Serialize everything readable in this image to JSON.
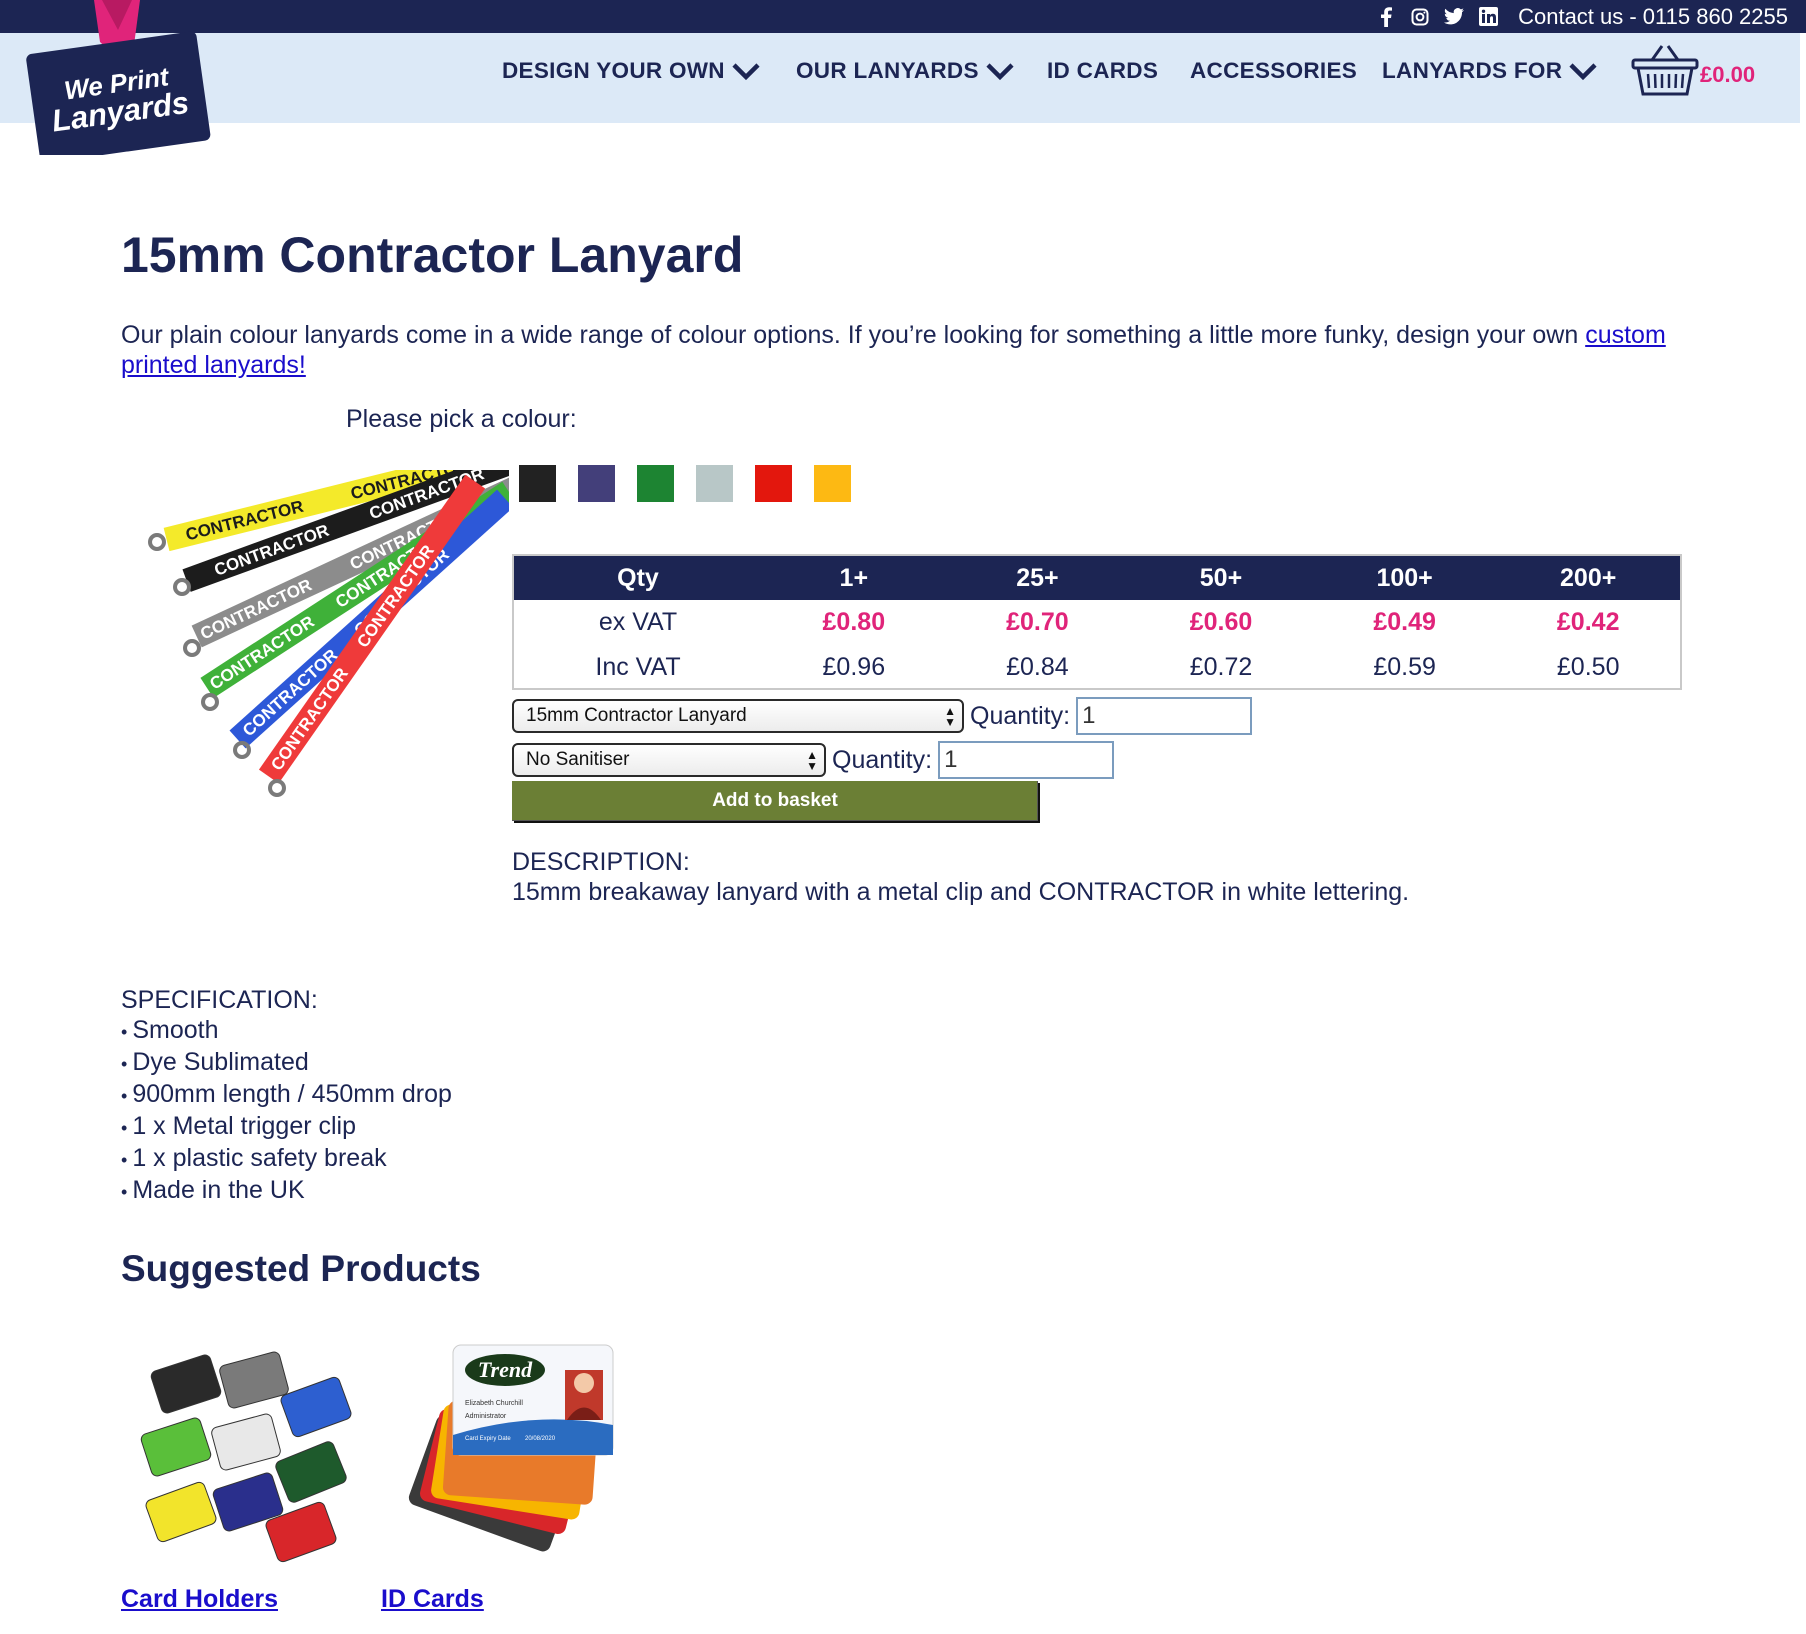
{
  "topbar": {
    "icons": [
      "facebook-icon",
      "instagram-icon",
      "twitter-icon",
      "linkedin-icon"
    ],
    "contact": "Contact us - 0115 860 2255"
  },
  "logo": {
    "line1": "We Print",
    "line2": "Lanyards"
  },
  "nav": {
    "items": [
      "DESIGN YOUR OWN",
      "OUR LANYARDS",
      "ID CARDS",
      "ACCESSORIES",
      "LANYARDS FOR"
    ],
    "basket_total": "£0.00"
  },
  "product": {
    "title": "15mm Contractor Lanyard",
    "intro_text": "Our plain colour lanyards come in a wide range of colour options. If you’re looking for something a little more funky, design your own ",
    "intro_link": "custom printed lanyards!",
    "pick_colour": "Please pick a colour:",
    "swatches": [
      "#222222",
      "#433f7a",
      "#1d8432",
      "#b8c7c7",
      "#e3170d",
      "#fdb913"
    ]
  },
  "pricing": {
    "headers": [
      "Qty",
      "1+",
      "25+",
      "50+",
      "100+",
      "200+"
    ],
    "ex_vat": [
      "ex VAT",
      "£0.80",
      "£0.70",
      "£0.60",
      "£0.49",
      "£0.42"
    ],
    "inc_vat": [
      "Inc VAT",
      "£0.96",
      "£0.84",
      "£0.72",
      "£0.59",
      "£0.50"
    ]
  },
  "order": {
    "product_select": "15mm Contractor Lanyard",
    "sanitiser_select": "No Sanitiser",
    "quantity_label": "Quantity:",
    "quantity1": "1",
    "quantity2": "1",
    "add_button": "Add to basket"
  },
  "description": {
    "heading": "DESCRIPTION:",
    "text": "15mm breakaway lanyard with a metal clip and CONTRACTOR in white lettering."
  },
  "specification": {
    "heading": "SPECIFICATION:",
    "items": [
      "Smooth",
      "Dye Sublimated",
      "900mm length / 450mm drop",
      "1 x Metal trigger clip",
      "1 x plastic safety break",
      "Made in the UK"
    ]
  },
  "suggested": {
    "heading": "Suggested Products",
    "items": [
      "Card Holders",
      "ID Cards"
    ],
    "id_card_brand": "Trend",
    "id_card_name": "Elizabeth Churchill",
    "id_card_role": "Administrator",
    "id_card_expiry_label": "Card Expiry Date",
    "id_card_expiry": "20/08/2020"
  },
  "lanyard_text": "CONTRACTOR"
}
